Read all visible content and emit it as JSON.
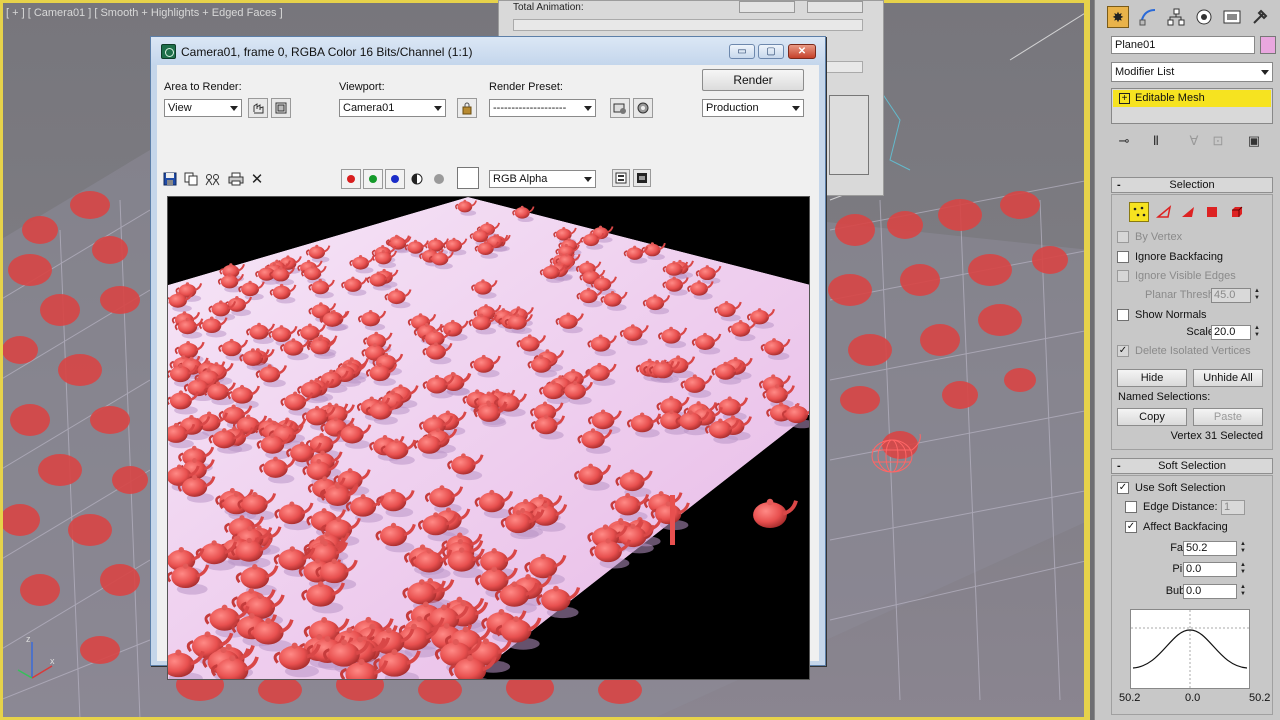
{
  "viewport": {
    "label": "[ + ] [ Camera01 ] [ Smooth + Highlights + Edged Faces ]",
    "axis_x": "x",
    "axis_z": "z"
  },
  "anim_dialog": {
    "label": "Total Animation:"
  },
  "render_window": {
    "title": "Camera01, frame 0, RGBA Color 16 Bits/Channel (1:1)",
    "area_to_render_label": "Area to Render:",
    "area_to_render_value": "View",
    "viewport_label": "Viewport:",
    "viewport_value": "Camera01",
    "render_preset_label": "Render Preset:",
    "render_preset_value": "--------------------",
    "render_button": "Render",
    "production_value": "Production",
    "channel_value": "RGB Alpha",
    "minimize": "▭",
    "maximize": "▢",
    "close": "✕"
  },
  "command_panel": {
    "object_name": "Plane01",
    "modifier_list": "Modifier List",
    "stack_item": "Editable Mesh",
    "selection": {
      "header": "Selection",
      "by_vertex": "By Vertex",
      "ignore_backfacing": "Ignore Backfacing",
      "ignore_visible_edges": "Ignore Visible Edges",
      "planar_thresh_label": "Planar Thresh:",
      "planar_thresh_value": "45.0",
      "show_normals": "Show Normals",
      "scale_label": "Scale:",
      "scale_value": "20.0",
      "delete_isolated": "Delete Isolated Vertices",
      "hide": "Hide",
      "unhide_all": "Unhide All",
      "named_selections": "Named Selections:",
      "copy": "Copy",
      "paste": "Paste",
      "status": "Vertex 31 Selected"
    },
    "soft_selection": {
      "header": "Soft Selection",
      "use_soft_selection": "Use Soft Selection",
      "edge_distance": "Edge Distance:",
      "edge_distance_value": "1",
      "affect_backfacing": "Affect Backfacing",
      "falloff_label": "Falloff:",
      "falloff_value": "50.2",
      "pinch_label": "Pinch:",
      "pinch_value": "0.0",
      "bubble_label": "Bubble:",
      "bubble_value": "0.0",
      "curve_left": "50.2",
      "curve_mid": "0.0",
      "curve_right": "50.2"
    }
  },
  "colors": {
    "active_viewport_border": "#e6d24a",
    "stack_highlight": "#f6e320",
    "teapot": "#e8504f",
    "render_bg": "#000000",
    "render_floor": "#f3d6f0"
  }
}
